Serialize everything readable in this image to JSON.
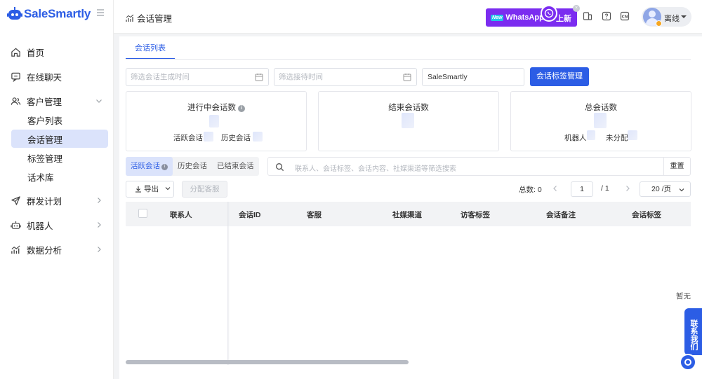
{
  "app": {
    "brand_name": "SaleSmartly",
    "brand_color": "#2c5de5"
  },
  "sidebar": {
    "items": [
      {
        "label": "首页",
        "icon": "home-icon"
      },
      {
        "label": "在线聊天",
        "icon": "chat-icon"
      },
      {
        "label": "客户管理",
        "icon": "users-icon",
        "expanded": true
      },
      {
        "label": "群发计划",
        "icon": "send-icon"
      },
      {
        "label": "机器人",
        "icon": "robot-icon"
      },
      {
        "label": "数据分析",
        "icon": "analytics-icon"
      }
    ],
    "sub_items": [
      {
        "label": "客户列表"
      },
      {
        "label": "会话管理",
        "active": true
      },
      {
        "label": "标签管理"
      },
      {
        "label": "话术库"
      }
    ]
  },
  "header": {
    "title": "会话管理",
    "promo": {
      "badge": "New",
      "text": "WhatsApp",
      "suffix": "上新",
      "close": "×"
    },
    "user_status": "离线"
  },
  "main": {
    "tab": "会话列表",
    "filters": {
      "date_start_placeholder": "筛选会话生成时间",
      "date_end_placeholder": "筛选接待时间",
      "channel_value": "SaleSmartly",
      "tag_manage_button": "会话标签管理"
    },
    "stats": {
      "ongoing": {
        "title": "进行中会话数",
        "active_label": "活跃会话",
        "history_label": "历史会话"
      },
      "ended": {
        "title": "结束会话数"
      },
      "total": {
        "title": "总会话数",
        "robot_label": "机器人",
        "unassigned_label": "未分配"
      }
    },
    "segments": [
      {
        "label": "活跃会话",
        "active": true
      },
      {
        "label": "历史会话"
      },
      {
        "label": "已结束会话"
      }
    ],
    "search": {
      "placeholder": "联系人、会话标签、会话内容、社媒渠道等筛选搜索",
      "reset": "重置"
    },
    "toolbar": {
      "export": "导出",
      "assign": "分配客服"
    },
    "pagination": {
      "total_label": "总数: 0",
      "page": "1",
      "of": "/ 1",
      "page_size": "20 /页"
    },
    "table": {
      "columns": [
        "联系人",
        "会话ID",
        "客服",
        "社媒渠道",
        "访客标签",
        "会话备注",
        "会话标签"
      ],
      "empty_text": "暂无"
    }
  },
  "float": {
    "contact_us": "联系我们"
  }
}
